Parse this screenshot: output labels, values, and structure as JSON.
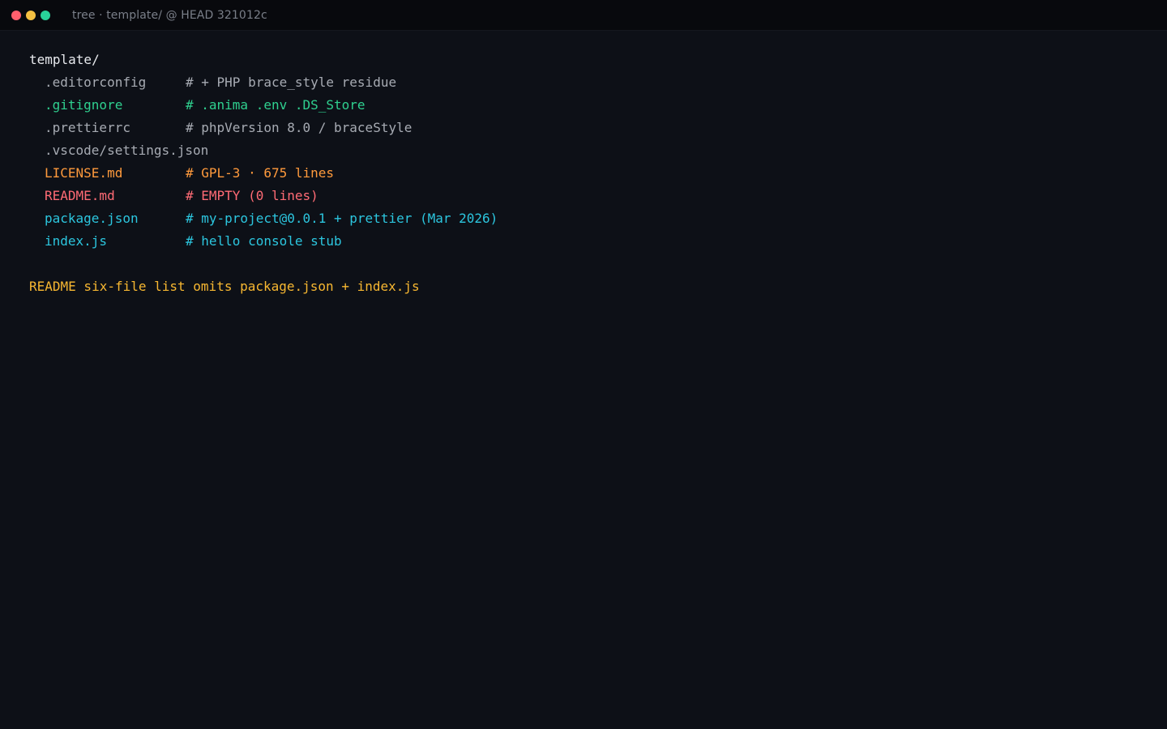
{
  "window": {
    "title": "tree · template/ @ HEAD 321012c"
  },
  "colors": {
    "background": "#0d1017",
    "titlebar": "#08090d",
    "gray": "#a7abb3",
    "green": "#2fd08f",
    "orange": "#ff9a3c",
    "red": "#ff6b75",
    "cyan": "#2cc6df",
    "yellow": "#f7b731"
  },
  "tree": {
    "root": "template/",
    "entries": [
      {
        "name": ".editorconfig",
        "comment": "# + PHP brace_style residue",
        "color": "gray"
      },
      {
        "name": ".gitignore",
        "comment": "# .anima .env .DS_Store",
        "color": "green"
      },
      {
        "name": ".prettierrc",
        "comment": "# phpVersion 8.0 / braceStyle",
        "color": "gray"
      },
      {
        "name": ".vscode/settings.json",
        "comment": "",
        "color": "gray"
      },
      {
        "name": "LICENSE.md",
        "comment": "# GPL-3 · 675 lines",
        "color": "orange"
      },
      {
        "name": "README.md",
        "comment": "# EMPTY (0 lines)",
        "color": "red"
      },
      {
        "name": "package.json",
        "comment": "# my-project@0.0.1 + prettier (Mar 2026)",
        "color": "cyan"
      },
      {
        "name": "index.js",
        "comment": "# hello console stub",
        "color": "cyan"
      }
    ]
  },
  "note": "README six-file list omits package.json + index.js"
}
